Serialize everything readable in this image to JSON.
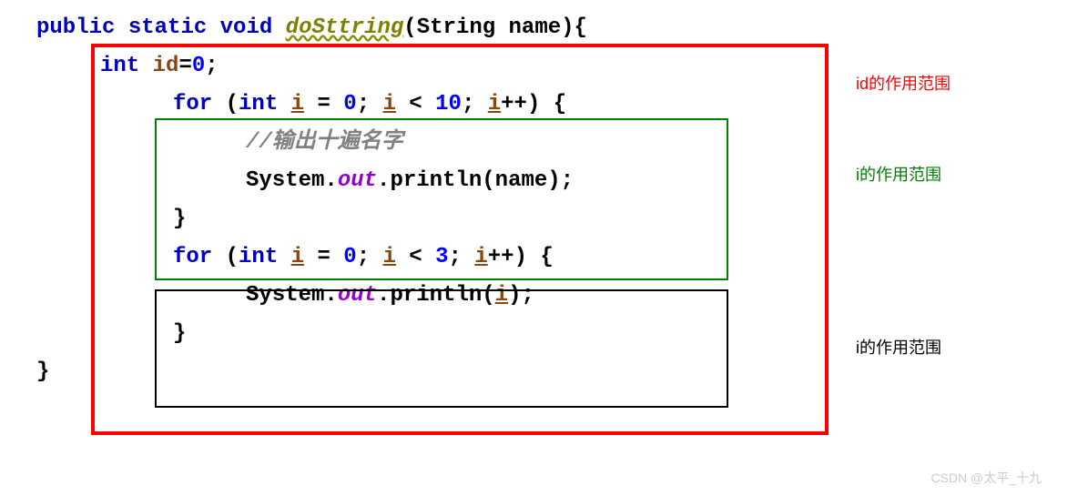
{
  "code": {
    "sig_public": "public",
    "sig_static": "static",
    "sig_void": "void",
    "method_name": "doSttring",
    "param_type": "String",
    "param_name": "name",
    "open_brace": "{",
    "line2_int": "int",
    "line2_var": "id",
    "line2_eq": "=",
    "line2_val": "0",
    "line2_semi": ";",
    "for1_for": "for",
    "for1_open": "(",
    "for1_int": "int",
    "for1_var": "i",
    "for1_eq": " = ",
    "for1_init": "0",
    "for1_semi1": "; ",
    "for1_var2": "i",
    "for1_lt": " < ",
    "for1_limit": "10",
    "for1_semi2": "; ",
    "for1_var3": "i",
    "for1_inc": "++",
    "for1_close": ") {",
    "comment1": "//输出十遍名字",
    "sys1": "System.",
    "out1": "out",
    "print1": ".println(name);",
    "close1": "}",
    "for2_for": "for",
    "for2_open": "(",
    "for2_int": "int",
    "for2_var": "i",
    "for2_eq": " = ",
    "for2_init": "0",
    "for2_semi1": "; ",
    "for2_var2": "i",
    "for2_lt": " < ",
    "for2_limit": "3",
    "for2_semi2": "; ",
    "for2_var3": "i",
    "for2_inc": "++",
    "for2_close": ") {",
    "sys2": "System.",
    "out2": "out",
    "print2": ".println(",
    "print2_var": "i",
    "print2_end": ");",
    "close2": "}",
    "close_method": "}"
  },
  "labels": {
    "red": "id的作用范围",
    "green": "i的作用范围",
    "black": "i的作用范围"
  },
  "watermark": "CSDN @太平_十九"
}
